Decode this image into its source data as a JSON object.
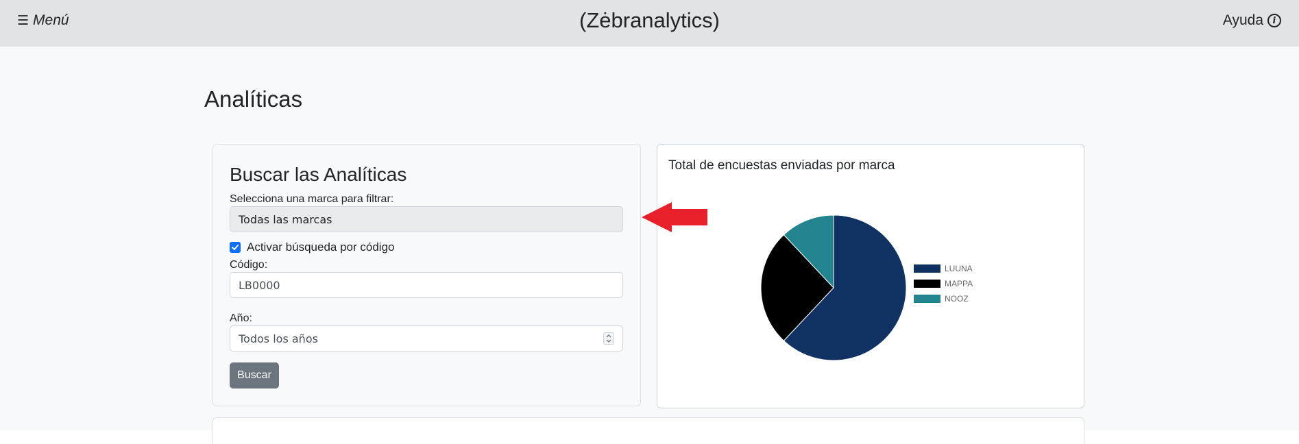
{
  "header": {
    "menu_label": "Menú",
    "brand": "(Zėbranalytics)",
    "help_label": "Ayuda"
  },
  "main": {
    "page_title": "Analíticas"
  },
  "search": {
    "title": "Buscar las Analíticas",
    "brand_label": "Selecciona una marca para filtrar:",
    "brand_value": "Todas las marcas",
    "code_toggle_label": "Activar búsqueda por código",
    "code_toggle_checked": true,
    "code_label": "Código:",
    "code_value": "LB0000",
    "year_label": "Año:",
    "year_value": "Todos los años",
    "submit_label": "Buscar"
  },
  "chart_data": {
    "type": "pie",
    "title": "Total de encuestas enviadas por marca",
    "legend_position": "right",
    "slices": [
      {
        "label": "LUUNA",
        "value": 62,
        "color": "#0f3262"
      },
      {
        "label": "MAPPA",
        "value": 26,
        "color": "#000000"
      },
      {
        "label": "NOOZ",
        "value": 12,
        "color": "#22848e"
      }
    ]
  },
  "colors": {
    "topbar": "#e2e3e5",
    "content_bg": "#f8f9fa",
    "primary_checkbox": "#0d6efd",
    "button_secondary": "#6c757d",
    "annotation_arrow": "#e8202a"
  }
}
